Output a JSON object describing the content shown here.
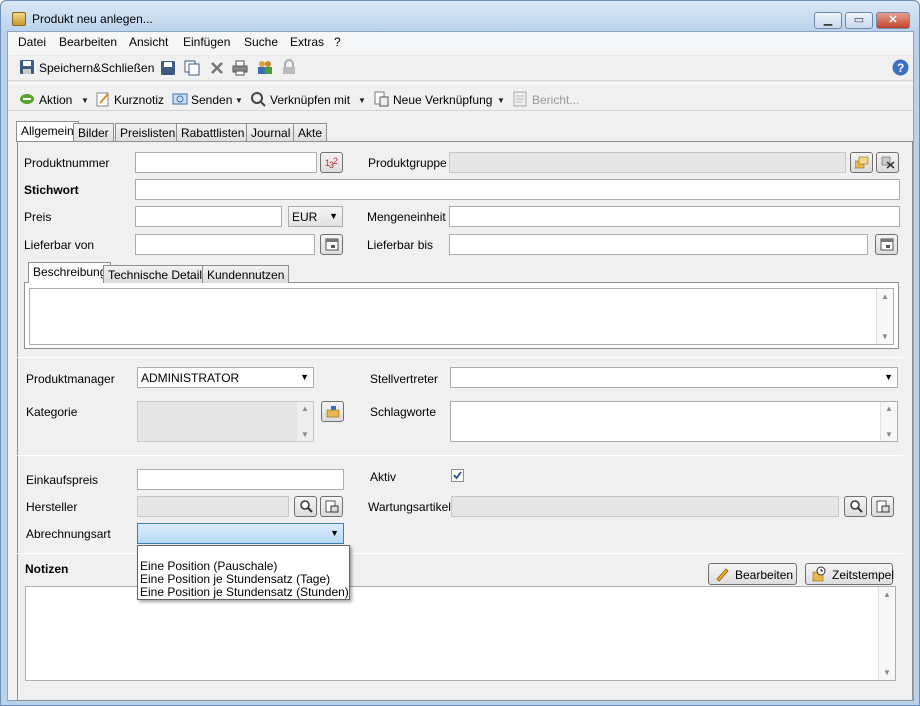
{
  "window": {
    "title": "Produkt neu anlegen..."
  },
  "menu": [
    "Datei",
    "Bearbeiten",
    "Ansicht",
    "Einfügen",
    "Suche",
    "Extras",
    "?"
  ],
  "toolbar1": {
    "save_close": "Speichern&Schließen"
  },
  "toolbar2": {
    "aktion": "Aktion",
    "kurznotiz": "Kurznotiz",
    "senden": "Senden",
    "verknuepfen": "Verknüpfen mit",
    "neue_verknuepfung": "Neue Verknüpfung",
    "bericht": "Bericht..."
  },
  "tabs": [
    "Allgemein",
    "Bilder",
    "Preislisten",
    "Rabattlisten",
    "Journal",
    "Akte"
  ],
  "form": {
    "produktnummer": "Produktnummer",
    "produktgruppe": "Produktgruppe",
    "stichwort": "Stichwort",
    "preis": "Preis",
    "currency": "EUR",
    "mengeneinheit": "Mengeneinheit",
    "lieferbar_von": "Lieferbar von",
    "lieferbar_bis": "Lieferbar bis"
  },
  "subtabs": [
    "Beschreibung",
    "Technische Details",
    "Kundennutzen"
  ],
  "section2": {
    "produktmanager": "Produktmanager",
    "produktmanager_value": "ADMINISTRATOR",
    "stellvertreter": "Stellvertreter",
    "kategorie": "Kategorie",
    "schlagworte": "Schlagworte"
  },
  "section3": {
    "einkaufspreis": "Einkaufspreis",
    "aktiv": "Aktiv",
    "hersteller": "Hersteller",
    "wartungsartikel": "Wartungsartikel",
    "abrechnungsart": "Abrechnungsart"
  },
  "abrechnungsart_options": [
    "Eine Position (Pauschale)",
    "Eine Position je Stundensatz (Tage)",
    "Eine Position je Stundensatz (Stunden)"
  ],
  "notizen": {
    "label": "Notizen",
    "bearbeiten": "Bearbeiten",
    "zeitstempel": "Zeitstempel"
  },
  "colors": {
    "titlebar": "#bcd3ec",
    "selection": "#3399ff",
    "client": "#f0f0f0"
  }
}
